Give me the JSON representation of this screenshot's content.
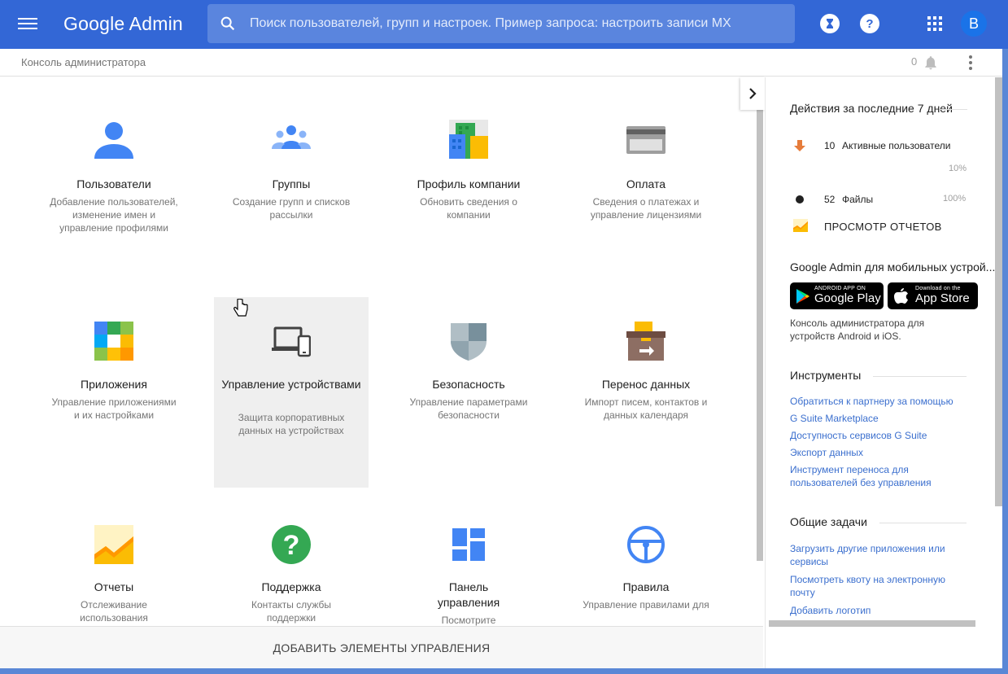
{
  "header": {
    "logo": "Google Admin",
    "search_placeholder": "Поиск пользователей, групп и настроек. Пример запроса: настроить записи MX",
    "avatar_letter": "B"
  },
  "subheader": {
    "breadcrumb": "Консоль администратора",
    "notifications_count": "0"
  },
  "tiles": [
    {
      "title": "Пользователи",
      "desc": "Добавление пользователей, изменение имен и управление профилями",
      "icon": "person-icon"
    },
    {
      "title": "Группы",
      "desc": "Создание групп и списков рассылки",
      "icon": "group-icon"
    },
    {
      "title": "Профиль компании",
      "desc": "Обновить сведения о компании",
      "icon": "building-icon"
    },
    {
      "title": "Оплата",
      "desc": "Сведения о платежах и управление лицензиями",
      "icon": "credit-card-icon"
    },
    {
      "title": "Приложения",
      "desc": "Управление приложениями и их настройками",
      "icon": "apps-grid-icon"
    },
    {
      "title": "Управление устройствами",
      "desc": "Защита корпоративных данных на устройствах",
      "icon": "devices-icon"
    },
    {
      "title": "Безопасность",
      "desc": "Управление параметрами безопасности",
      "icon": "shield-icon"
    },
    {
      "title": "Перенос данных",
      "desc": "Импорт писем, контактов и данных календаря",
      "icon": "migration-box-icon"
    },
    {
      "title": "Отчеты",
      "desc": "Отслеживание использования",
      "icon": "reports-chart-icon"
    },
    {
      "title": "Поддержка",
      "desc": "Контакты службы поддержки",
      "icon": "help-icon"
    },
    {
      "title": "Панель управления",
      "desc": "Посмотрите",
      "icon": "dashboard-icon"
    },
    {
      "title": "Правила",
      "desc": "Управление правилами для",
      "icon": "steering-wheel-icon"
    }
  ],
  "bottom_bar": {
    "label": "ДОБАВИТЬ ЭЛЕМЕНТЫ УПРАВЛЕНИЯ"
  },
  "right_panel": {
    "activity_title": "Действия за последние 7 дней",
    "active_users": {
      "count": "10",
      "label": "Активные пользователи",
      "pct": "10%"
    },
    "files": {
      "count": "52",
      "label": "Файлы",
      "pct": "100%"
    },
    "reports_link": "ПРОСМОТР ОТЧЕТОВ",
    "mobile_title": "Google Admin для мобильных устрой...",
    "google_play": {
      "small": "ANDROID APP ON",
      "big": "Google Play"
    },
    "app_store": {
      "small": "Download on the",
      "big": "App Store"
    },
    "mobile_desc": "Консоль администратора для устройств Android и iOS.",
    "tools_title": "Инструменты",
    "tools": [
      "Обратиться к партнеру за помощью",
      "G Suite Marketplace",
      "Доступность сервисов G Suite",
      "Экспорт данных",
      "Инструмент переноса для пользователей без управления"
    ],
    "tasks_title": "Общие задачи",
    "tasks": [
      "Загрузить другие приложения или сервисы",
      "Посмотреть квоту на электронную почту",
      "Добавить логотип"
    ]
  },
  "colors": {
    "brand_blue": "#3367d6",
    "link_blue": "#3b6fce",
    "accent_orange": "#e67c3b"
  }
}
